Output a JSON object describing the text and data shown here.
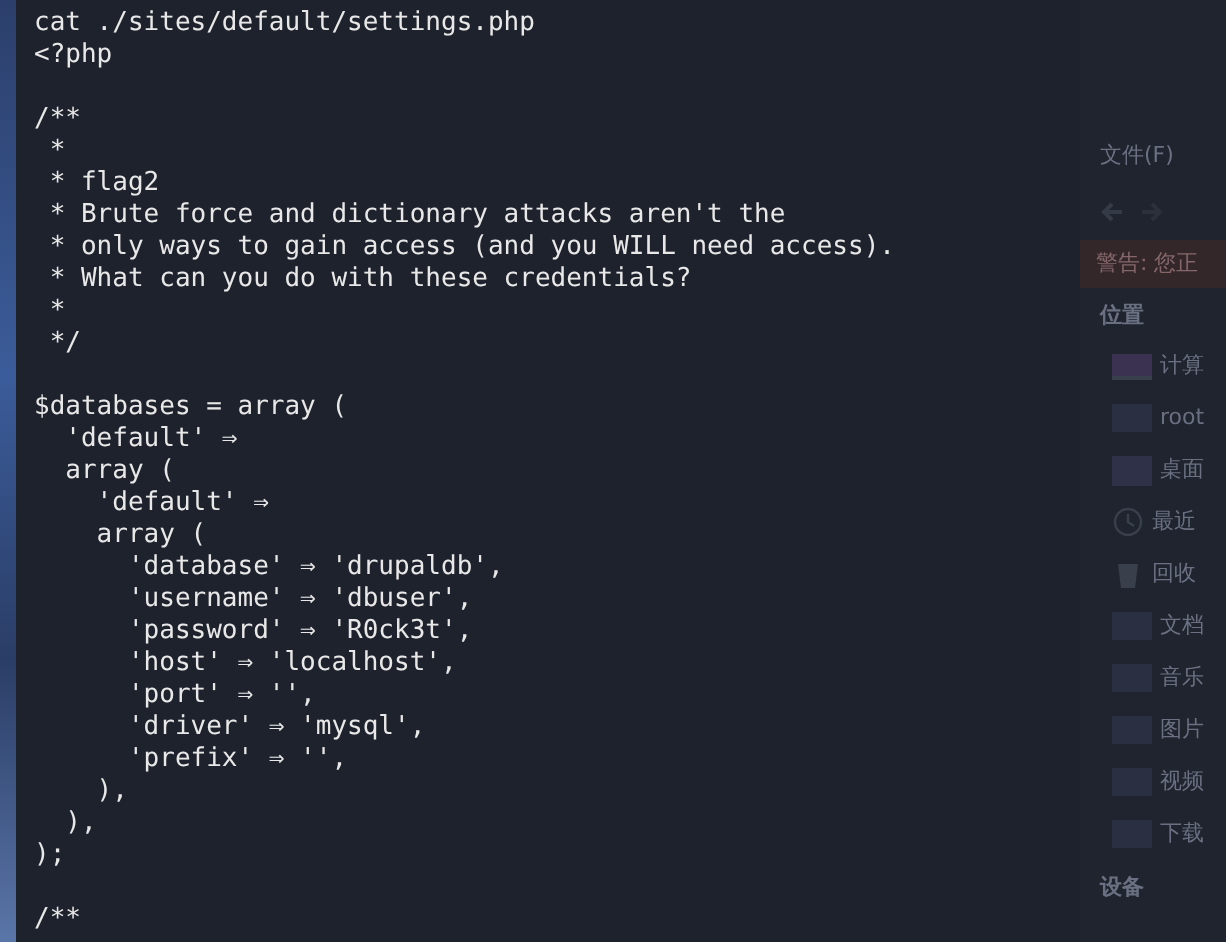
{
  "terminal": {
    "blocks": [
      [
        "cat ./sites/default/settings.php",
        "<?php"
      ],
      [
        "/**",
        " *",
        " * flag2",
        " * Brute force and dictionary attacks aren't the",
        " * only ways to gain access (and you WILL need access).",
        " * What can you do with these credentials?",
        " *",
        " */"
      ],
      [
        "$databases = array (",
        "  'default' ⇒",
        "  array (",
        "    'default' ⇒",
        "    array (",
        "      'database' ⇒ 'drupaldb',",
        "      'username' ⇒ 'dbuser',",
        "      'password' ⇒ 'R0ck3t',",
        "      'host' ⇒ 'localhost',",
        "      'port' ⇒ '',",
        "      'driver' ⇒ 'mysql',",
        "      'prefix' ⇒ '',",
        "    ),",
        "  ),",
        ");"
      ],
      [
        "/**"
      ]
    ]
  },
  "file_manager": {
    "menu": "文件(F)",
    "warning": "警告: 您正",
    "places_heading": "位置",
    "places": [
      {
        "kind": "computer",
        "label": "计算"
      },
      {
        "kind": "folder",
        "label": "root"
      },
      {
        "kind": "desktop",
        "label": "桌面"
      },
      {
        "kind": "recent",
        "label": "最近"
      },
      {
        "kind": "trash",
        "label": "回收"
      },
      {
        "kind": "folder",
        "label": "文档"
      },
      {
        "kind": "folder",
        "label": "音乐"
      },
      {
        "kind": "folder",
        "label": "图片"
      },
      {
        "kind": "folder",
        "label": "视频"
      },
      {
        "kind": "folder",
        "label": "下载"
      }
    ],
    "devices_heading": "设备"
  }
}
